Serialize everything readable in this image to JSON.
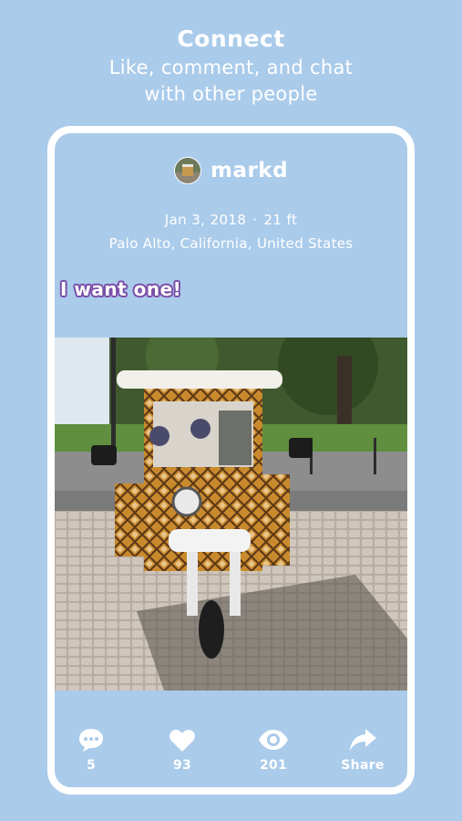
{
  "promo": {
    "title": "Connect",
    "subtitle_line1": "Like, comment, and chat",
    "subtitle_line2": "with other people"
  },
  "post": {
    "username": "markd",
    "date": "Jan 3, 2018",
    "distance": "21 ft",
    "location": "Palo Alto, California, United States",
    "caption": "I want one!",
    "photo_subject": "patterned tuk-tuk on cobblestone street"
  },
  "actions": {
    "comments": "5",
    "likes": "93",
    "views": "201",
    "share": "Share"
  },
  "icons": {
    "comment": "speech-bubble-icon",
    "like": "heart-icon",
    "views": "eye-icon",
    "share": "share-arrow-icon"
  },
  "colors": {
    "background": "#aacbea",
    "caption_outline": "#7a4fa8",
    "text": "#ffffff"
  }
}
